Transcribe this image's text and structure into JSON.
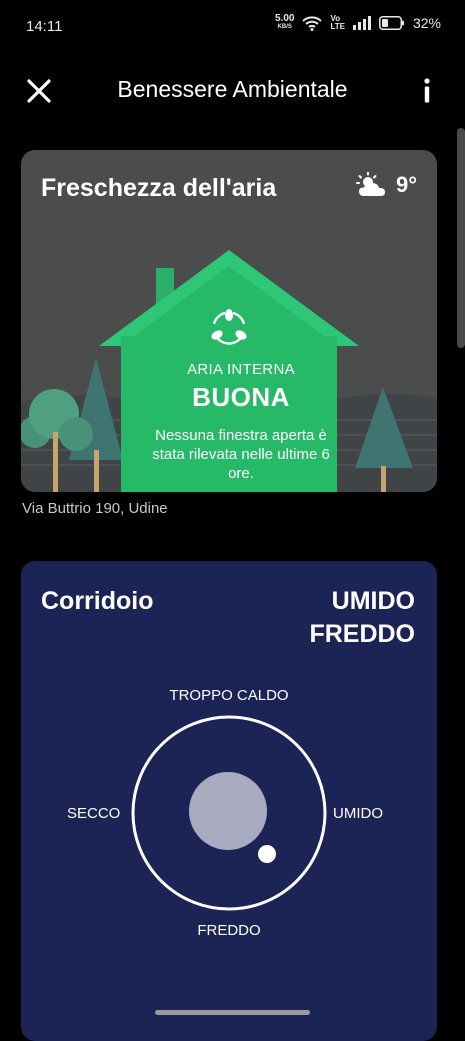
{
  "status_bar": {
    "time": "14:11",
    "net_speed": "5.00",
    "net_unit": "KB/S",
    "volte_top": "Vo",
    "volte_bottom": "LTE",
    "battery_pct": "32%"
  },
  "header": {
    "title": "Benessere Ambientale",
    "close_icon": "close-icon",
    "info_icon": "info-icon"
  },
  "air_card": {
    "title": "Freschezza dell'aria",
    "temperature": "9°",
    "weather_icon": "partly-cloudy-icon",
    "label": "ARIA INTERNA",
    "status": "BUONA",
    "description": "Nessuna finestra aperta è stata rilevata nelle ultime 6 ore.",
    "address": "Via Buttrio 190, Udine",
    "colors": {
      "background": "#4b4d4d",
      "house": "#25b968",
      "roof": "#2ec778"
    }
  },
  "room_card": {
    "name": "Corridoio",
    "status_line1": "UMIDO",
    "status_line2": "FREDDO",
    "axis_top": "TROPPO CALDO",
    "axis_bottom": "FREDDO",
    "axis_left": "SECCO",
    "axis_right": "UMIDO",
    "colors": {
      "background": "#1b2455",
      "blob": "#a9abc0"
    }
  }
}
